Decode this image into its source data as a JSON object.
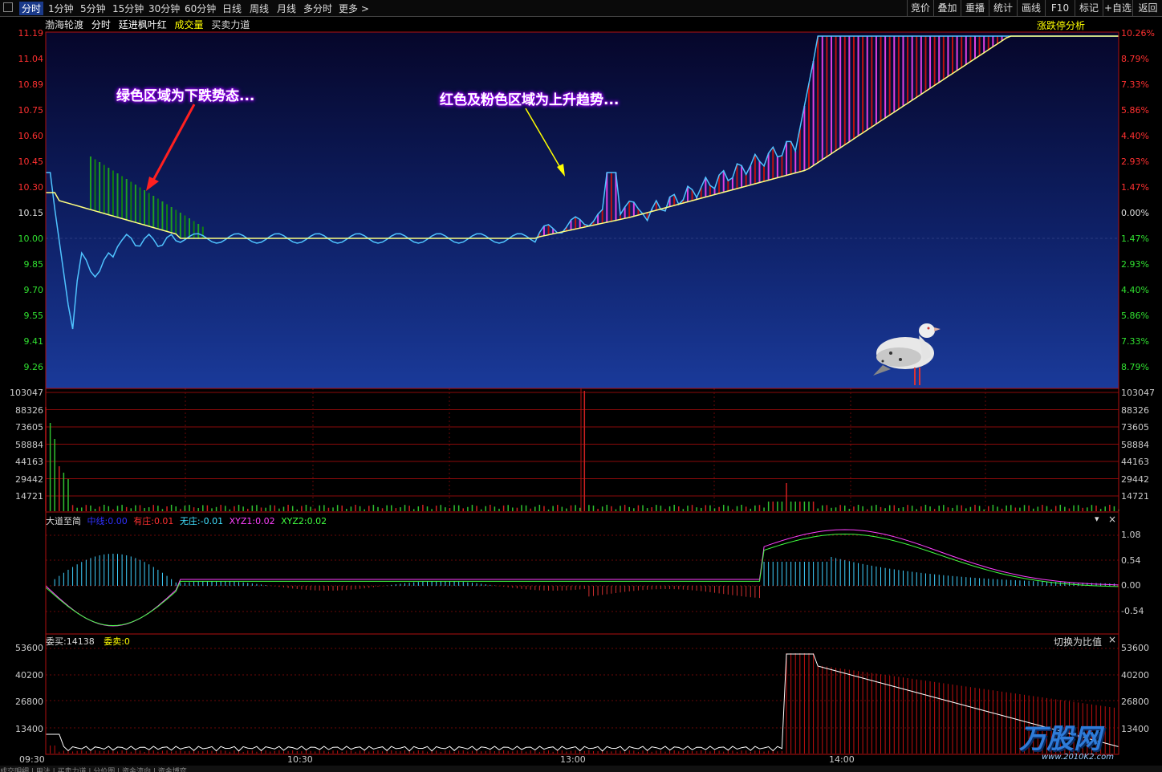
{
  "toolbar": {
    "tabs": [
      "分时",
      "1分钟",
      "5分钟",
      "15分钟",
      "30分钟",
      "60分钟",
      "日线",
      "周线",
      "月线",
      "多分时",
      "更多 >"
    ],
    "right_buttons": [
      "竞价",
      "叠加",
      "重播",
      "统计",
      "画线",
      "F10",
      "标记",
      "+自选",
      "返回"
    ]
  },
  "title": {
    "stock": "渤海轮渡",
    "mode": "分时",
    "indicator1": "廷进枫叶红",
    "indicator2": "成交量",
    "indicator3": "买卖力道",
    "right_label": "涨跌停分析"
  },
  "price_axis": {
    "left": [
      "11.19",
      "11.04",
      "10.89",
      "10.75",
      "10.60",
      "10.45",
      "10.30",
      "10.15",
      "10.00",
      "9.85",
      "9.70",
      "9.55",
      "9.41",
      "9.26"
    ],
    "right": [
      "10.26%",
      "8.79%",
      "7.33%",
      "5.86%",
      "4.40%",
      "2.93%",
      "1.47%",
      "0.00%",
      "1.47%",
      "2.93%",
      "4.40%",
      "5.86%",
      "7.33%",
      "8.79%"
    ]
  },
  "volume_axis": [
    "103047",
    "88326",
    "73605",
    "58884",
    "44163",
    "29442",
    "14721"
  ],
  "indicator_panel": {
    "name": "大道至简",
    "mid_label": "中线:",
    "mid_value": "0.00",
    "zhuang_label": "有庄:",
    "zhuang_value": "0.01",
    "wuzhuang_label": "无庄:",
    "wuzhuang_value": "-0.01",
    "xyz1_label": "XYZ1:",
    "xyz1_value": "0.02",
    "xyz2_label": "XYZ2:",
    "xyz2_value": "0.02",
    "axis": [
      "1.08",
      "0.54",
      "0.00",
      "-0.54"
    ]
  },
  "order_panel": {
    "buy_label": "委买:14138",
    "sell_label": "委卖:0",
    "switch_label": "切换为比值",
    "axis": [
      "53600",
      "40200",
      "26800",
      "13400"
    ]
  },
  "time_axis": [
    "09:30",
    "10:30",
    "13:00",
    "14:00"
  ],
  "annotations": {
    "green": "绿色区域为下跌势态...",
    "red": "红色及粉色区域为上升趋势..."
  },
  "watermark": {
    "text": "万股网",
    "url": "www.2010K2.com"
  },
  "bottom_tabs": "成交明细 | 用法 | 买卖力道 | 分价图 | 资金流向 | 资金博弈",
  "colors": {
    "accent": "#d01010",
    "price_line": "#4fc3ff",
    "avg_line": "#ffff80",
    "pink": "#e040e0",
    "green": "#10a010"
  }
}
